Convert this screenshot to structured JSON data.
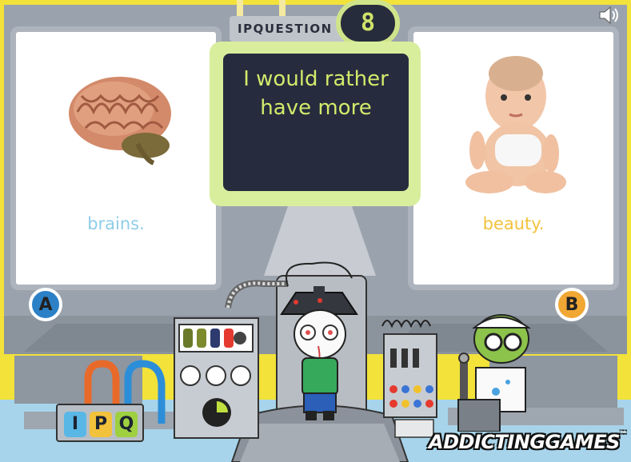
{
  "game": {
    "section_label": "IPQUESTION",
    "question_number": "8",
    "question_text": "I would rather have more",
    "sound_icon": "speaker-icon"
  },
  "option_a": {
    "badge": "A",
    "image": "brain",
    "answer": "brains.",
    "color": "#8ecde8",
    "badge_color": "#2c80c6"
  },
  "option_b": {
    "badge": "B",
    "image": "baby",
    "answer": "beauty.",
    "color": "#f2c23c",
    "badge_color": "#f1a734"
  },
  "machine": {
    "letters": [
      "I",
      "P",
      "Q"
    ]
  },
  "logo": {
    "text": "ADDICTINGGAMES",
    "tm": "™"
  }
}
